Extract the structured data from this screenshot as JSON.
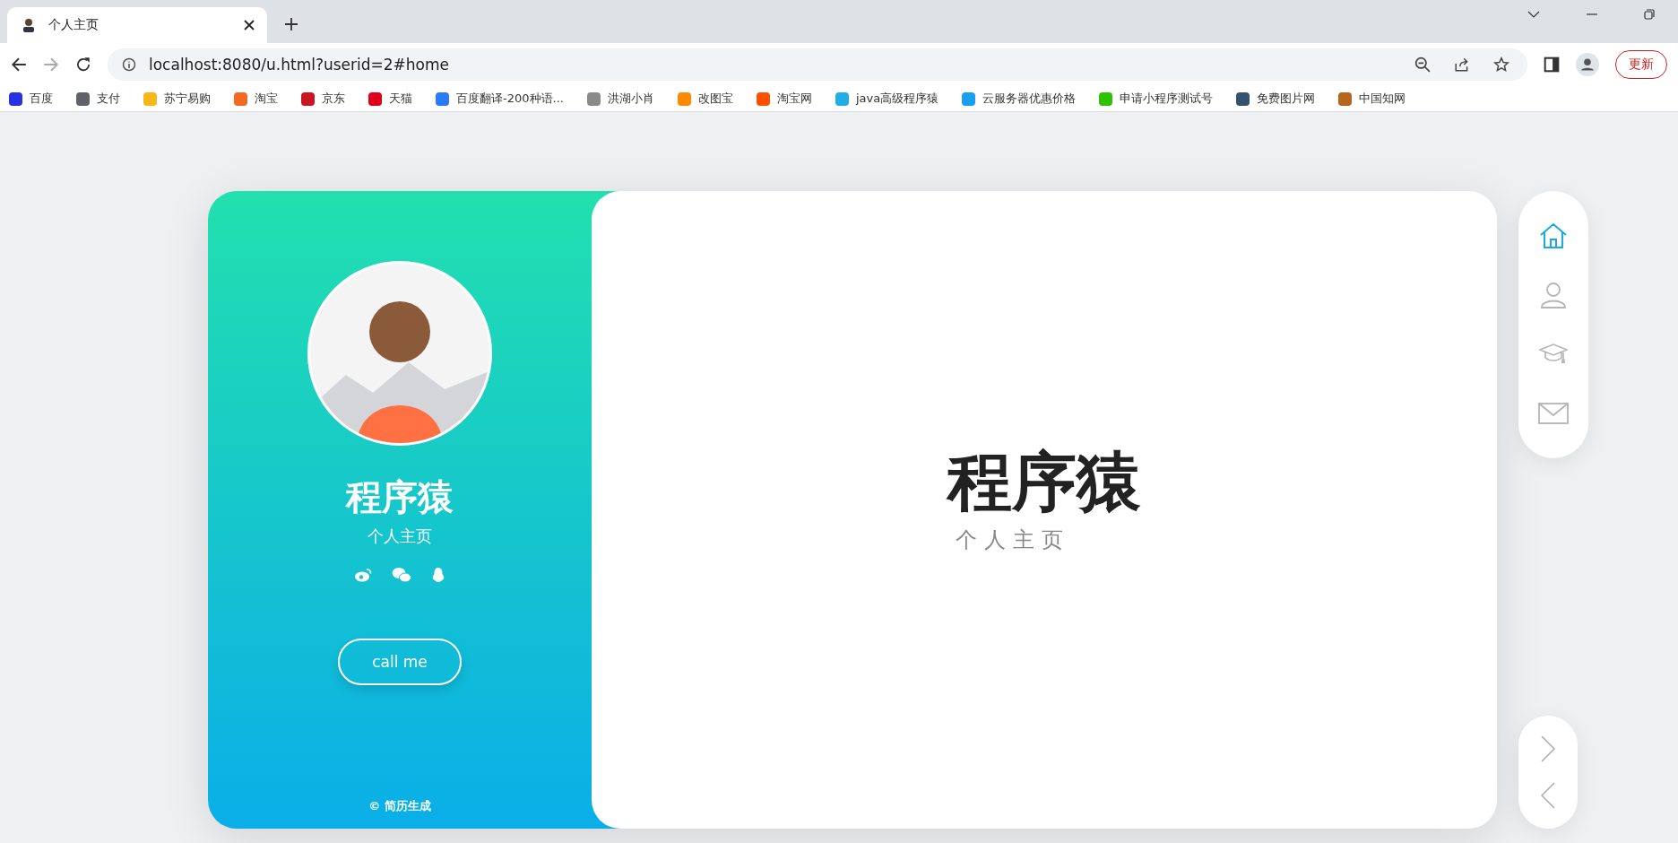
{
  "browser": {
    "tab": {
      "title": "个人主页"
    },
    "address": "localhost:8080/u.html?userid=2#home",
    "update_button": "更新",
    "bookmarks": [
      {
        "label": "百度",
        "color": "#2932e1"
      },
      {
        "label": "支付",
        "color": "#5f6368"
      },
      {
        "label": "苏宁易购",
        "color": "#f5b71a"
      },
      {
        "label": "淘宝",
        "color": "#f26a21"
      },
      {
        "label": "京东",
        "color": "#c91623"
      },
      {
        "label": "天猫",
        "color": "#e0001b"
      },
      {
        "label": "百度翻译-200种语...",
        "color": "#2a7cf6"
      },
      {
        "label": "洪湖小肖",
        "color": "#8a8a8a"
      },
      {
        "label": "改图宝",
        "color": "#ff8a00"
      },
      {
        "label": "淘宝网",
        "color": "#ff5000"
      },
      {
        "label": "java高级程序猿",
        "color": "#23ade5"
      },
      {
        "label": "云服务器优惠价格",
        "color": "#1a9ef0"
      },
      {
        "label": "申请小程序测试号",
        "color": "#2dc100"
      },
      {
        "label": "免费图片网",
        "color": "#34526f"
      },
      {
        "label": "中国知网",
        "color": "#b5651d"
      }
    ]
  },
  "profile": {
    "name": "程序猿",
    "subtitle": "个人主页",
    "call_button": "call me",
    "footer": "© 简历生成"
  },
  "main": {
    "title": "程序猿",
    "subtitle": "个人主页"
  },
  "nav": {
    "items": [
      {
        "kind": "home",
        "selected": true
      },
      {
        "kind": "person",
        "selected": false
      },
      {
        "kind": "education",
        "selected": false
      },
      {
        "kind": "mail",
        "selected": false
      }
    ]
  }
}
